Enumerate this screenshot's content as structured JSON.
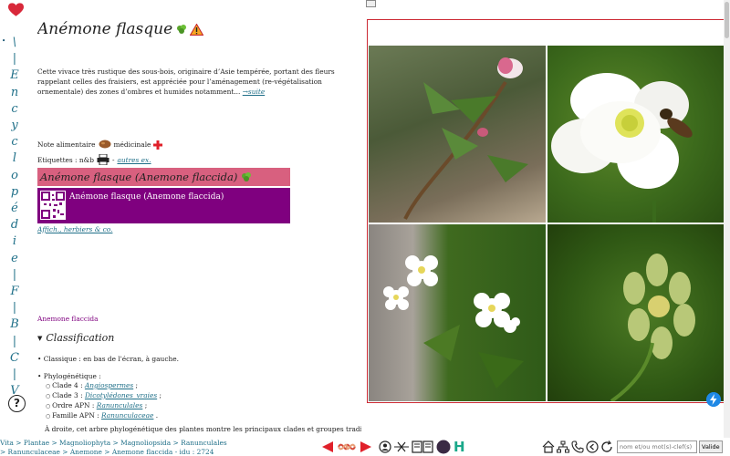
{
  "rail": {
    "letters": [
      "\\",
      "|",
      "E",
      "n",
      "c",
      "y",
      "c",
      "l",
      "o",
      "p",
      "é",
      "d",
      "i",
      "e",
      "|",
      "F",
      "|",
      "B",
      "|",
      "C",
      "|",
      "V"
    ],
    "help_label": "?"
  },
  "article": {
    "title": "Anémone flasque",
    "intro": "Cette vivace très rustique des sous-bois, originaire d’Asie tempérée, portant des fleurs rappelant celles des fraisiers, est appréciée pour l’aménagement (re-végétalisation ornementale) des zones d’ombres et humides notamment...",
    "more_link": "→suite",
    "note_label": "Note alimentaire",
    "medicinal_label": "médicinale",
    "tags_label": "Etiquettes : n&b",
    "other_examples_link": "autres ex.",
    "pink_bar_label": "Anémone flasque (Anemone flaccida)",
    "purple_box_label": "Anémone flasque (Anemone flaccida)",
    "affich_link": "Affich., herbiers & co.",
    "latin_name": "Anemone flaccida",
    "classification_heading": "Classification",
    "classique": "Classique : en bas de l'écran, à gauche.",
    "phylo_title": "Phylogénétique :",
    "phylo_items": [
      {
        "prefix": "Clade 4 :",
        "link": "Angiospermes",
        "suffix": ";"
      },
      {
        "prefix": "Clade 3 :",
        "link": "Dicotylédones_vraies",
        "suffix": ";"
      },
      {
        "prefix": "Ordre APN :",
        "link": "Ranunculales",
        "suffix": ";"
      },
      {
        "prefix": "Famille APN :",
        "link": "Ranunculaceae",
        "suffix": "."
      }
    ],
    "overflow_text": "À droite, cet arbre phylogénétique des plantes montre les principaux clades et groupes traditionnels (monophylétiques ou paraphylétiques en bleu)."
  },
  "breadcrumb": {
    "items": [
      "Vita",
      "Plantae",
      "Magnoliophyta",
      "Magnoliopsida",
      "Ranunculales",
      "Ranunculaceae",
      "Anemone",
      "Anemone flaccida"
    ],
    "idu": "- idu : 2724"
  },
  "search": {
    "placeholder": "nom et/ou mot(s)-clef(s)",
    "button_label": "Valide"
  },
  "toolbar": {
    "h_label": "H"
  },
  "colors": {
    "accent_teal": "#1f6f88",
    "pink_bar": "#d8607f",
    "purple_box": "#7f007f",
    "photo_border": "#cc2a34",
    "nav_red": "#e0202a"
  }
}
